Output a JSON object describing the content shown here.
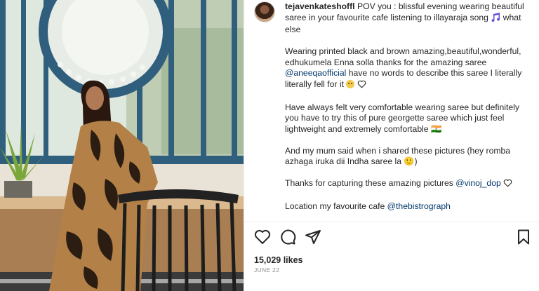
{
  "post": {
    "username": "tejavenkateshoffl",
    "caption_intro": " POV you : blissful evening wearing beautiful saree in your favourite cafe listening to illayaraja song",
    "caption_intro_tail": " what else",
    "para2_a": "Wearing printed black and brown amazing,beautiful,wonderful, edhukumela Enna solla thanks for the amazing saree ",
    "mention_saree": "@aneeqaofficial",
    "para2_b": " have no words to describe this saree I literally literally fell for it ",
    "para3": "Have always felt very comfortable wearing saree but definitely you have to try this of pure georgette saree which just feel lightweight and extremely comfortable 🇮🇳",
    "para4": "And my mum said when i shared these pictures (hey romba azhaga iruka dii Indha saree la 🙂)",
    "para5_a": "Thanks for capturing these amazing pictures ",
    "mention_photographer": "@vinoj_dop",
    "para6_a": "Location my favourite cafe ",
    "mention_location": "@thebistrograph",
    "likes": "15,029 likes",
    "date": "JUNE 22"
  },
  "icons": {
    "music": "music-note-icon",
    "face": "smiling-face-icon",
    "heart": "heart-outline-icon",
    "like": "like-heart-icon",
    "comment": "comment-bubble-icon",
    "share": "paper-plane-icon",
    "save": "bookmark-icon"
  },
  "colors": {
    "mention": "#00376b",
    "text": "#262626",
    "muted": "#8e8e8e",
    "music_icon": "#6b4fd8"
  }
}
